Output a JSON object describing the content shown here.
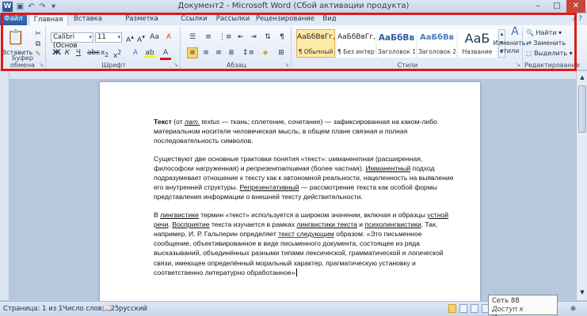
{
  "window": {
    "title": "Документ2 - Microsoft Word (Сбой активации продукта)",
    "app_icon_letter": "W"
  },
  "tabs": [
    "Файл",
    "Главная",
    "Вставка",
    "Разметка страницы",
    "Ссылки",
    "Рассылки",
    "Рецензирование",
    "Вид"
  ],
  "ribbon": {
    "clipboard": {
      "paste_label": "Вставить",
      "group_label": "Буфер обмена"
    },
    "font": {
      "font_name": "Calibri (Основ",
      "font_size": "11",
      "group_label": "Шрифт"
    },
    "paragraph": {
      "group_label": "Абзац"
    },
    "styles": {
      "group_label": "Стили",
      "items": [
        {
          "preview": "АаБбВвГг,",
          "name": "¶ Обычный"
        },
        {
          "preview": "АаБбВвГг,",
          "name": "¶ Без интер..."
        },
        {
          "preview": "АаБбВв",
          "name": "Заголовок 1"
        },
        {
          "preview": "АаБбВв",
          "name": "Заголовок 2"
        },
        {
          "preview": "АаБ",
          "name": "Название"
        }
      ],
      "change_styles_label": "Изменить стили"
    },
    "editing": {
      "group_label": "Редактирование",
      "find": "Найти",
      "replace": "Заменить",
      "select": "Выделить"
    }
  },
  "document": {
    "p1": {
      "bold": "Текст",
      "t1": " (от ",
      "lat": "лат.",
      "t2": " ",
      "textus": "textus",
      "t3": " — ткань; сплетение, сочетание) — зафиксированная на каком-либо материальном носителе человеческая мысль; в общем плане связная и полная последовательность символов."
    },
    "p2": {
      "t1": "Существуют две основные трактовки понятия «текст»: ",
      "i1": "имманентная",
      "t2": " (расширенная, философски нагруженная) и ",
      "i2": "репрезентативная",
      "t3": " (более частная). ",
      "u1": "Имманентный",
      "t4": " подход подразумевает отношение к тексту как к автономной реальности, нацеленность на выявление его внутренней структуры. ",
      "u2": "Репрезентативный",
      "t5": " — рассмотрение текста как особой формы представления информации о внешней тексту действительности."
    },
    "p3": {
      "t1": "В ",
      "u1": "лингвистике",
      "t2": " термин «текст» используется в широком значении, включая и образцы ",
      "u2": "устной речи",
      "t3": ". ",
      "u3": "Восприятие",
      "t4": " текста изучается в рамках ",
      "u4": "лингвистики текста",
      "t5": " и ",
      "u5": "психолингвистики",
      "t6": ". Так, например, И. Р. Гальперин определяет ",
      "u6": "текст следующим",
      "t7": " образом: «Это письменное сообщение, объективированное в виде письменного документа, состоящее из ряда высказываний, объединённых разными типами лексической, грамматической и логической связи, имеющее определённый моральный характер, прагматическую установку и соответственно литературно обработанное»"
    }
  },
  "status": {
    "page": "Страница: 1 из 1",
    "words": "Число слов: 125",
    "language": "русский"
  },
  "tooltip": {
    "title": "Сеть  88",
    "subtitle": "Доступ к Интернету"
  },
  "colors": {
    "highlight_frame": "#e01818",
    "file_tab": "#2b5fa8"
  }
}
